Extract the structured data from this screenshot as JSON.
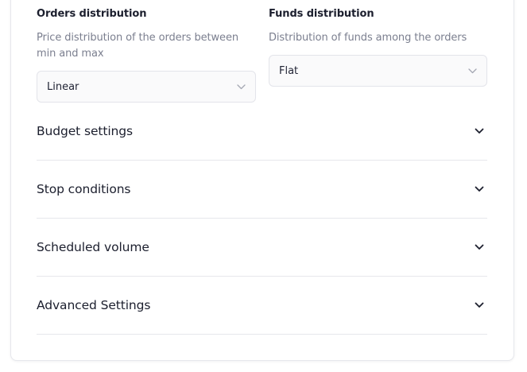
{
  "orders_distribution": {
    "title": "Orders distribution",
    "description": "Price distribution of the orders between min and max",
    "selected": "Linear",
    "chevron_icon": "chevron-down-icon"
  },
  "funds_distribution": {
    "title": "Funds distribution",
    "description": "Distribution of funds among the orders",
    "selected": "Flat",
    "chevron_icon": "chevron-down-icon"
  },
  "sections": [
    {
      "label": "Budget settings",
      "icon": "chevron-down-icon"
    },
    {
      "label": "Stop conditions",
      "icon": "chevron-down-icon"
    },
    {
      "label": "Scheduled volume",
      "icon": "chevron-down-icon"
    },
    {
      "label": "Advanced Settings",
      "icon": "chevron-down-icon"
    }
  ],
  "colors": {
    "text": "#1c1f2e",
    "muted": "#7b7f8f",
    "border": "#e6e7ec",
    "select_bg": "#fafafb"
  }
}
